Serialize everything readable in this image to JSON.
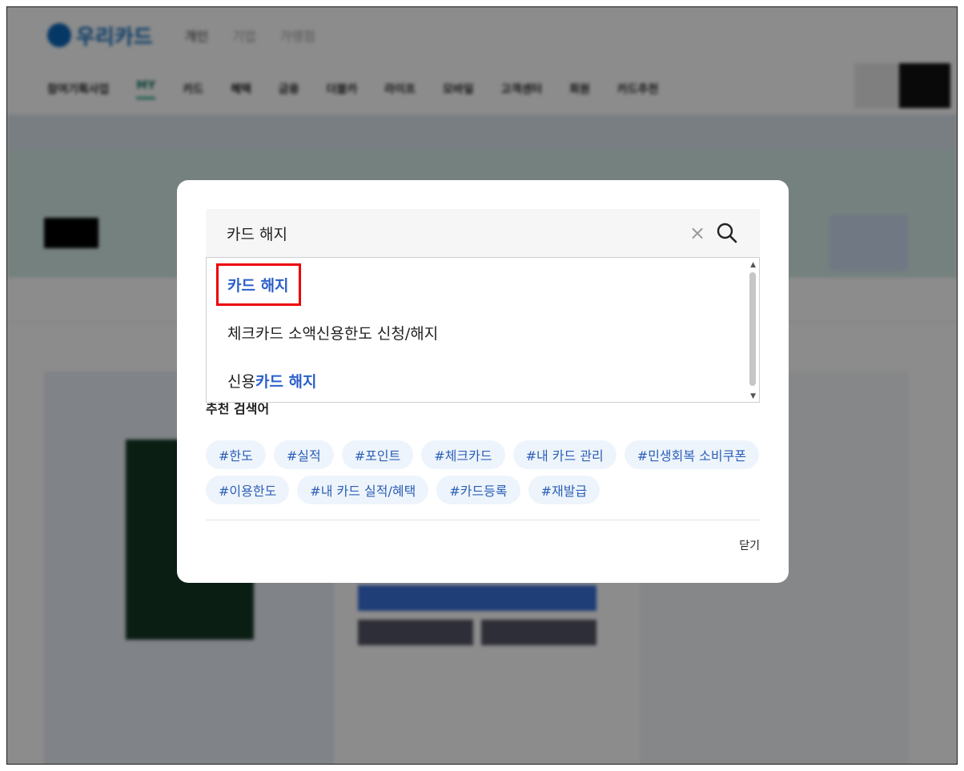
{
  "background": {
    "logo_text": "우리카드",
    "segments": [
      "개인",
      "기업",
      "가맹점"
    ],
    "gnb": [
      "참여기획사업",
      "MY",
      "카드",
      "혜택",
      "금융",
      "더블카",
      "라이프",
      "모바일",
      "고객센터",
      "회원",
      "카드추천"
    ]
  },
  "search": {
    "query": "카드 해지",
    "clear_icon": "close-icon",
    "search_icon": "search-icon"
  },
  "suggestions": [
    {
      "prefix": "",
      "highlight": "카드 해지",
      "suffix": ""
    },
    {
      "prefix": "체크카드 소액신용한도 신청/해지",
      "highlight": "",
      "suffix": ""
    },
    {
      "prefix": "신용",
      "highlight": "카드 해지",
      "suffix": ""
    }
  ],
  "recent": {
    "title": "추천 검색어"
  },
  "tags": [
    "#한도",
    "#실적",
    "#포인트",
    "#체크카드",
    "#내 카드 관리",
    "#민생회복 소비쿠폰",
    "#이용한도",
    "#내 카드 실적/혜택",
    "#카드등록",
    "#재발급"
  ],
  "close_label": "닫기"
}
